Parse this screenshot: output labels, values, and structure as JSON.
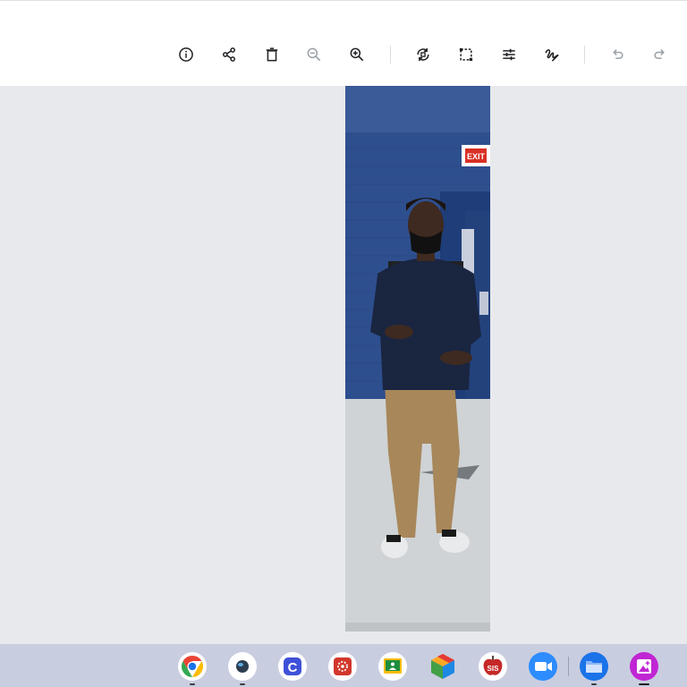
{
  "toolbar": {
    "buttons": [
      {
        "name": "info",
        "icon": "info-icon",
        "enabled": true
      },
      {
        "name": "share",
        "icon": "share-icon",
        "enabled": true
      },
      {
        "name": "delete",
        "icon": "trash-icon",
        "enabled": true
      },
      {
        "name": "zoom-out",
        "icon": "zoom-out-icon",
        "enabled": false
      },
      {
        "name": "zoom-in",
        "icon": "zoom-in-icon",
        "enabled": true
      },
      {
        "name": "rotate",
        "icon": "rotate-icon",
        "enabled": true
      },
      {
        "name": "crop",
        "icon": "crop-icon",
        "enabled": true
      },
      {
        "name": "adjust",
        "icon": "sliders-icon",
        "enabled": true
      },
      {
        "name": "markup",
        "icon": "squiggle-pen-icon",
        "enabled": true
      },
      {
        "name": "undo",
        "icon": "undo-icon",
        "enabled": false
      },
      {
        "name": "redo",
        "icon": "redo-icon",
        "enabled": false
      }
    ]
  },
  "photo": {
    "sign_text": "EXIT",
    "colors": {
      "wall": "#2e4f8e",
      "floor": "#cfd3d6",
      "shirt": "#1a2540",
      "pants": "#a8875a"
    }
  },
  "shelf": {
    "apps": [
      {
        "name": "chrome",
        "icon": "chrome-icon",
        "running": true
      },
      {
        "name": "app-dark-circle",
        "icon": "dark-globe-icon",
        "running": true
      },
      {
        "name": "app-c",
        "icon": "c-letter-icon",
        "label": "C",
        "running": false
      },
      {
        "name": "app-red-gear",
        "icon": "red-gear-icon",
        "running": false
      },
      {
        "name": "classroom",
        "icon": "classroom-icon",
        "running": false
      },
      {
        "name": "app-cube",
        "icon": "color-cube-icon",
        "running": false
      },
      {
        "name": "sis",
        "icon": "sis-apple-icon",
        "label": "SIS",
        "running": false
      },
      {
        "name": "zoom",
        "icon": "zoom-camera-icon",
        "running": false
      },
      {
        "name": "files",
        "icon": "folder-icon",
        "running": true
      },
      {
        "name": "gallery",
        "icon": "gallery-icon",
        "running": true,
        "active": true
      }
    ]
  }
}
